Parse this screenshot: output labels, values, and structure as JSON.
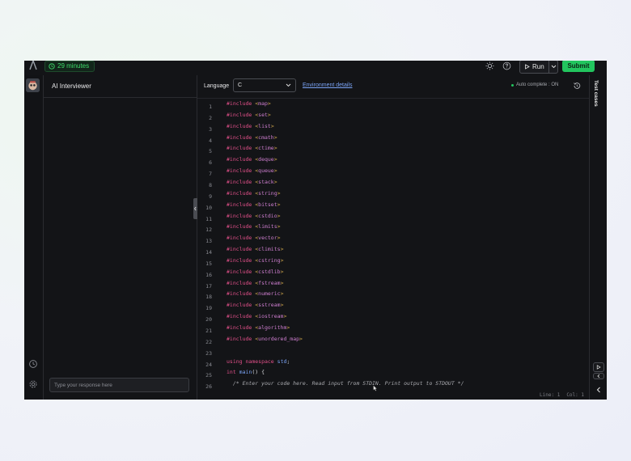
{
  "topbar": {
    "timer": "29 minutes",
    "run_label": "Run",
    "submit_label": "Submit"
  },
  "chat": {
    "title": "AI Interviewer",
    "input_placeholder": "Type your response here"
  },
  "editor": {
    "language_label": "Language",
    "language_value": "C",
    "environment_link": "Environment details",
    "autocomplete": "Auto complete : ON",
    "line_numbers": [
      "1",
      "2",
      "3",
      "4",
      "5",
      "6",
      "7",
      "8",
      "9",
      "10",
      "11",
      "12",
      "13",
      "14",
      "15",
      "16",
      "17",
      "18",
      "19",
      "20",
      "21",
      "22",
      "23",
      "24",
      "25",
      "26"
    ],
    "includes": [
      "map",
      "set",
      "list",
      "cmath",
      "ctime",
      "deque",
      "queue",
      "stack",
      "string",
      "bitset",
      "cstdio",
      "limits",
      "vector",
      "climits",
      "cstring",
      "cstdlib",
      "fstream",
      "numeric",
      "sstream",
      "iostream",
      "algorithm",
      "unordered_map"
    ],
    "include_keyword": "#include",
    "using_line": {
      "kw1": "using",
      "kw2": "namespace",
      "ns": "std",
      "end": ";"
    },
    "main_line": {
      "type": "int",
      "name": "main",
      "rest": "() {"
    },
    "comment_line": "/* Enter your code here. Read input from STDIN. Print output to STDOUT */",
    "status_line": "Line: 1",
    "status_col": "Col: 1"
  },
  "tests": {
    "label": "Test cases"
  },
  "colors": {
    "accent_green": "#22c55e",
    "link_blue": "#7aa3f5",
    "keyword_pink": "#e3508a"
  }
}
